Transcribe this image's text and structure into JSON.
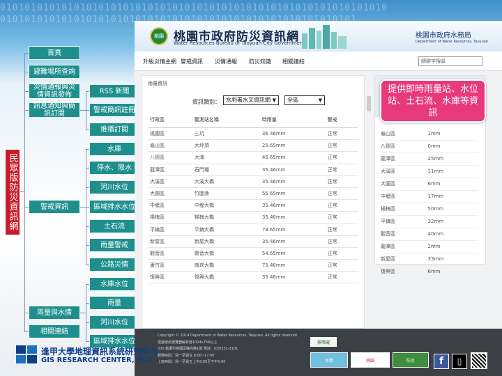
{
  "background_binary": "010101010101010101010101010101010101010101010101010101010101010\n0101010101010101010101010101010101010101010101010101010101",
  "app_title_vertical": "民眾版防災資訊網",
  "tree": {
    "level1": [
      "首頁",
      "避難場所查詢",
      "災情通報與災情資訊發佈",
      "訊息通知與簡訊訂閱",
      "警戒資訊",
      "雨量與水情",
      "相關連結"
    ],
    "subscribe_children": [
      "RSS 新聞",
      "警戒簡訊註冊",
      "推播訂閱"
    ],
    "alert_children": [
      "水庫",
      "停水、限水",
      "河川水位",
      "區域排水水位",
      "土石流",
      "雨量警戒",
      "公路災情"
    ],
    "rain_children": [
      "水庫水位",
      "雨量",
      "河川水位",
      "區域排水水位"
    ]
  },
  "site": {
    "logo_text": "桃園",
    "title": "桃園市政府防災資訊網",
    "subtitle": "Water Resources Bureau of Taoyuan City Government",
    "dept_name": "桃園市政府水務局",
    "dept_english": "Department of Water Resources, Taoyuan",
    "nav": [
      "升級災情主網",
      "警戒資訊",
      "災情通報",
      "防災知識",
      "相關連結"
    ],
    "search_placeholder": "關鍵字搜尋",
    "content_title": "雨量資訊",
    "filter_label": "資訊類別：",
    "filter_value": "水利署水文資訊網",
    "district_value": "全區",
    "table_headers": [
      "行政區",
      "觀測站名稱",
      "時雨量",
      "警戒"
    ],
    "rows": [
      [
        "桃園區",
        "三坑",
        "36.46mm",
        "正常"
      ],
      [
        "龜山區",
        "大坪頂",
        "25.65mm",
        "正常"
      ],
      [
        "八德區",
        "大湳",
        "45.65mm",
        "正常"
      ],
      [
        "龍潭區",
        "石門壩",
        "35.46mm",
        "正常"
      ],
      [
        "大溪區",
        "大溪大橋",
        "35.46mm",
        "正常"
      ],
      [
        "大園區",
        "竹圍漁",
        "55.65mm",
        "正常"
      ],
      [
        "中壢區",
        "中壢大橋",
        "35.46mm",
        "正常"
      ],
      [
        "楊梅區",
        "楊梅大橋",
        "35.46mm",
        "正常"
      ],
      [
        "平鎮區",
        "平鎮大橋",
        "78.65mm",
        "正常"
      ],
      [
        "新屋區",
        "新屋大橋",
        "35.46mm",
        "正常"
      ],
      [
        "觀音區",
        "觀音大橋",
        "54.65mm",
        "正常"
      ],
      [
        "蘆竹區",
        "南崁大橋",
        "75.46mm",
        "正常"
      ],
      [
        "復興區",
        "復興大橋",
        "35.46mm",
        "正常"
      ]
    ],
    "side_rows": [
      [
        "龜山區",
        "1mm"
      ],
      [
        "八德區",
        "0mm"
      ],
      [
        "龍潭區",
        "25mm"
      ],
      [
        "大溪區",
        "11mm"
      ],
      [
        "大園區",
        "6mm"
      ],
      [
        "中壢區",
        "17mm"
      ],
      [
        "楊梅區",
        "50mm"
      ],
      [
        "平鎮區",
        "32mm"
      ],
      [
        "觀音區",
        "40mm"
      ],
      [
        "龍潭區",
        "2mm"
      ],
      [
        "新屋區",
        "33mm"
      ],
      [
        "復興區",
        "6mm"
      ]
    ],
    "footer_lines": [
      "Copyright © 2014 Department of Water Resources, Taoyuan. All rights reserved.",
      "建議使用瀏覽器解析度1024x768以上",
      "330 桃園市桃園區縣府路1號 電話：(03)332-2101",
      "服務時間：週一至週五 8:00~17:00",
      "上班時間：週一至週五上午8:00至下午5:00"
    ],
    "footer_badges": [
      "無障礙",
      "水情",
      "桃園",
      "防災"
    ]
  },
  "callout": "提供即時雨量站、水位站、土石流、水庫等資訊",
  "gis": {
    "name": "逢甲大學地理資訊系統研究中心",
    "english": "GIS RESEARCH CENTER, FCU"
  },
  "colors": {
    "node": "#1e8f8e",
    "vertical_title": "#c51d2a",
    "callout": "#e7397b",
    "footer": "#3c4045"
  }
}
